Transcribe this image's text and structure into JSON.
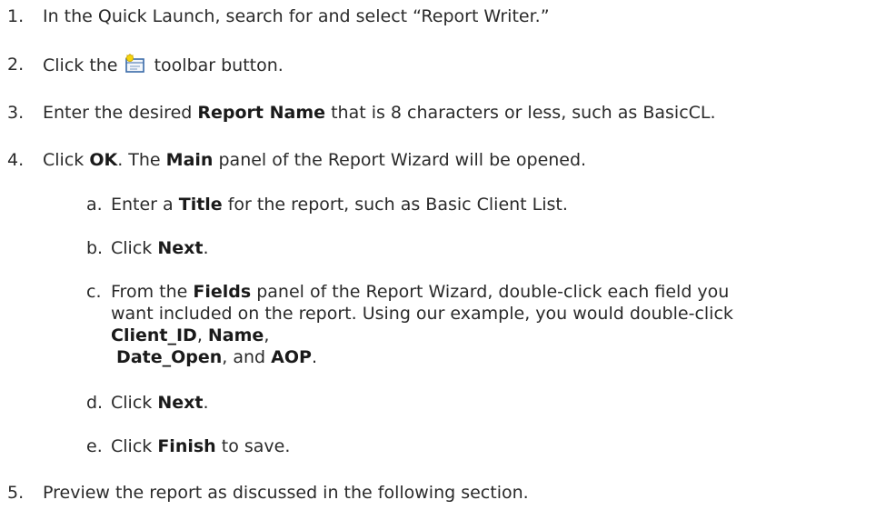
{
  "steps": [
    {
      "num": "1.",
      "parts": [
        "In the Quick Launch, search for and select “Report Writer.”"
      ]
    },
    {
      "num": "2.",
      "before": "Click the",
      "after": "toolbar button.",
      "icon": "new-report-icon"
    },
    {
      "num": "3.",
      "parts": [
        "Enter the desired ",
        "Report Name",
        " that is 8 characters or less, such as BasicCL."
      ]
    },
    {
      "num": "4.",
      "parts": [
        "Click ",
        "OK",
        ". The ",
        "Main",
        " panel of the Report Wizard will be opened."
      ]
    },
    {
      "num": "5.",
      "parts": [
        "Preview the report as discussed in the following section."
      ]
    }
  ],
  "substeps": [
    {
      "num": "a.",
      "parts": [
        "Enter a ",
        "Title",
        " for the report, such as Basic Client List."
      ]
    },
    {
      "num": "b.",
      "parts": [
        "Click ",
        "Next",
        "."
      ]
    },
    {
      "num": "c.",
      "lines": [
        [
          "From the ",
          "Fields",
          " panel of the Report Wizard, double-click each field you"
        ],
        [
          "want included on the report. Using our example, you would double-click"
        ],
        [
          "Client_ID",
          ", ",
          "Name",
          ","
        ],
        [
          " ",
          "Date_Open",
          ", and ",
          "AOP",
          "."
        ]
      ]
    },
    {
      "num": "d.",
      "parts": [
        "Click ",
        "Next",
        "."
      ]
    },
    {
      "num": "e.",
      "parts": [
        "Click ",
        "Finish",
        " to save."
      ]
    }
  ]
}
